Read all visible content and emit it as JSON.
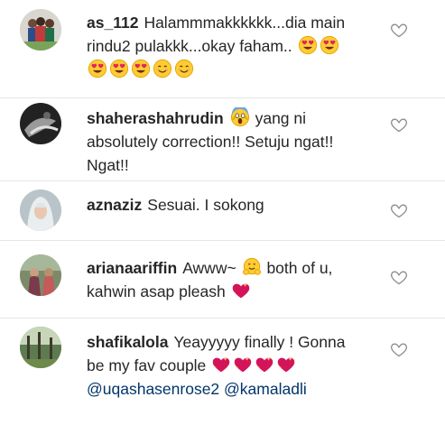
{
  "comments": [
    {
      "username": "as_112",
      "text_parts": [
        "Halammmakkkkkk...dia main rindu2 pulakkk...okay faham.."
      ],
      "emojis": [
        "heart-eyes-emoji",
        "heart-eyes-emoji",
        "heart-eyes-emoji",
        "heart-eyes-emoji",
        "heart-eyes-emoji",
        "smiling-emoji",
        "smiling-emoji"
      ]
    },
    {
      "username": "shaherashahrudin",
      "lead_emoji": "screaming-face-emoji",
      "text": "yang ni absolutely correction!! Setuju ngat!! Ngat!!"
    },
    {
      "username": "aznaziz",
      "text": "Sesuai. I sokong"
    },
    {
      "username": "arianaariffin",
      "text_a": "Awww~",
      "mid_emoji": "hugging-face-emoji",
      "text_b": "both of u, kahwin asap pleash",
      "end_emoji": "sparkling-heart-emoji"
    },
    {
      "username": "shafikalola",
      "text": "Yeayyyyy finally ! Gonna be my fav couple",
      "emojis": [
        "sparkling-heart-emoji",
        "sparkling-heart-emoji",
        "sparkling-heart-emoji",
        "sparkling-heart-emoji"
      ],
      "mention_1": "@uqashasenrose2",
      "mention_2": "@kamaladli"
    }
  ],
  "icons": {
    "like": "heart-outline-icon"
  },
  "colors": {
    "text": "#262626",
    "mention": "#003569",
    "divider": "#e6e6e6",
    "heart_outline": "#8e8e8e"
  }
}
